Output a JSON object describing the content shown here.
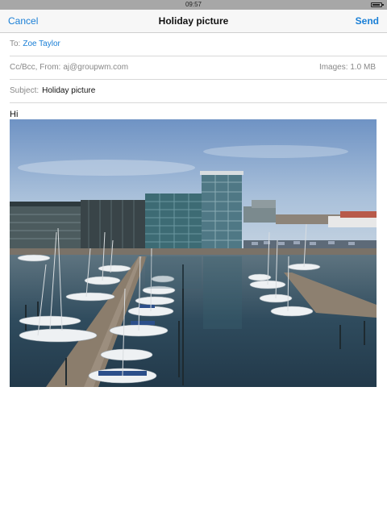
{
  "status_bar": {
    "time": "09:57"
  },
  "nav": {
    "cancel_label": "Cancel",
    "title": "Holiday picture",
    "send_label": "Send"
  },
  "compose": {
    "to_label": "To:",
    "to_value": "Zoe Taylor",
    "ccbcc_label": "Cc/Bcc, From:",
    "from_value": "aj@groupwm.com",
    "images_label": "Images:",
    "images_size": "1.0 MB",
    "subject_label": "Subject:",
    "subject_value": "Holiday picture",
    "body_text": "Hi"
  },
  "icons": {
    "battery": "battery-icon"
  },
  "colors": {
    "accent": "#1a7fd6",
    "status_bar": "#a7a7a7"
  }
}
